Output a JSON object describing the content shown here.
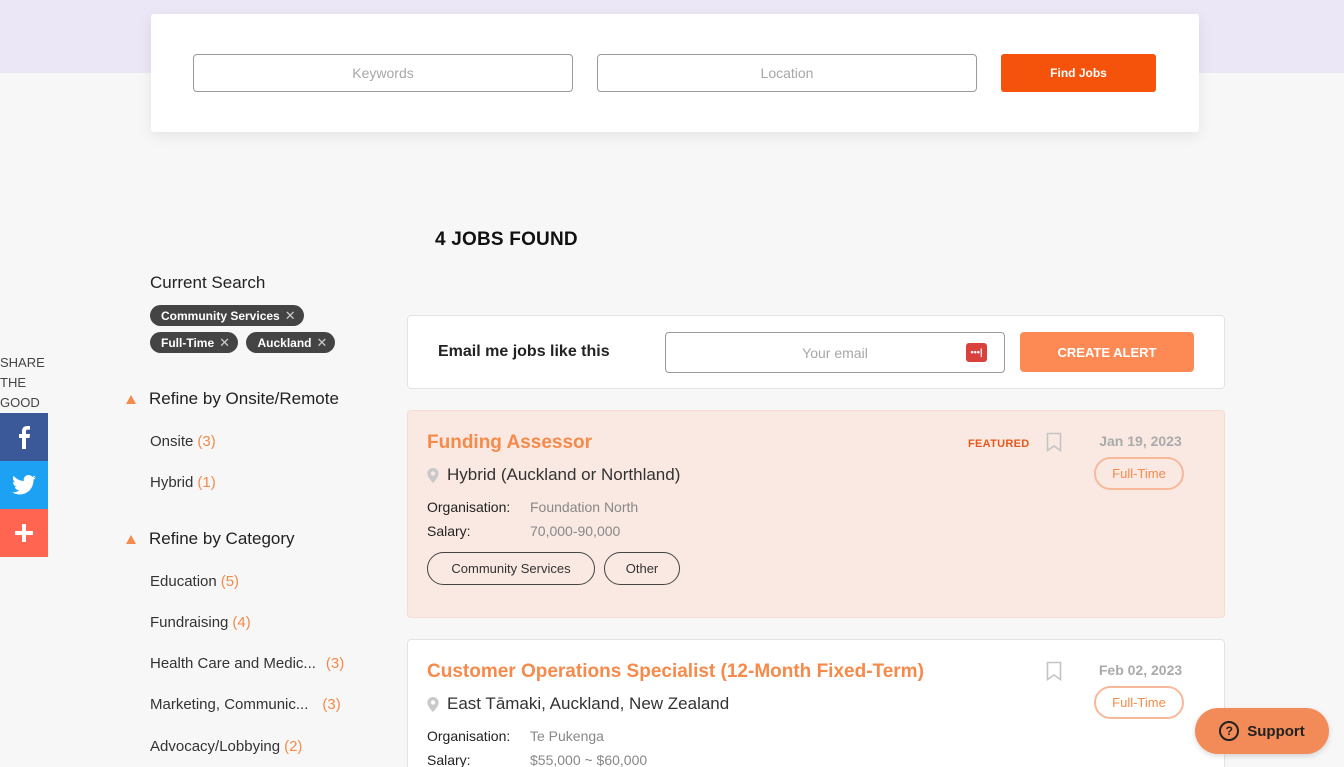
{
  "search": {
    "keywords_placeholder": "Keywords",
    "location_placeholder": "Location",
    "find_label": "Find Jobs"
  },
  "results": {
    "count_label": "4 JOBS FOUND"
  },
  "share": {
    "label_lines": [
      "SHARE",
      "THE",
      "GOOD"
    ],
    "icons": [
      "facebook-icon",
      "twitter-icon",
      "plus-icon"
    ]
  },
  "sidebar": {
    "current_search_label": "Current Search",
    "chips": [
      "Community Services",
      "Full-Time",
      "Auckland"
    ],
    "chip_remove_glyph": "✕",
    "refine_remote": {
      "title": "Refine by Onsite/Remote",
      "items": [
        {
          "label": "Onsite",
          "count": "(3)"
        },
        {
          "label": "Hybrid",
          "count": "(1)"
        }
      ]
    },
    "refine_category": {
      "title": "Refine by Category",
      "items": [
        {
          "label": "Education",
          "count": "(5)"
        },
        {
          "label": "Fundraising",
          "count": "(4)"
        },
        {
          "label": "Health Care and Medic...",
          "count": "(3)"
        },
        {
          "label": "Marketing, Communic...",
          "count": "(3)"
        },
        {
          "label": "Advocacy/Lobbying",
          "count": "(2)"
        }
      ]
    }
  },
  "alert": {
    "label": "Email me jobs like this",
    "email_placeholder": "Your email",
    "create_label": "CREATE ALERT",
    "pw_glyph": "•••|"
  },
  "jobs": [
    {
      "title": "Funding Assessor",
      "location": "Hybrid (Auckland or Northland)",
      "organisation_label": "Organisation:",
      "organisation": "Foundation North",
      "salary_label": "Salary:",
      "salary": "70,000-90,000",
      "categories": [
        "Community Services",
        "Other"
      ],
      "featured": "FEATURED",
      "date": "Jan 19, 2023",
      "type": "Full-Time"
    },
    {
      "title": "Customer Operations Specialist (12-Month Fixed-Term)",
      "location": "East Tāmaki, Auckland, New Zealand",
      "organisation_label": "Organisation:",
      "organisation": "Te Pukenga",
      "salary_label": "Salary:",
      "salary": "$55,000 ~ $60,000",
      "date": "Feb 02, 2023",
      "type": "Full-Time"
    }
  ],
  "support": {
    "label": "Support",
    "glyph": "?"
  },
  "colors": {
    "accent": "#f58a4a",
    "find_button": "#f5520c",
    "band": "#ebe7f7"
  }
}
